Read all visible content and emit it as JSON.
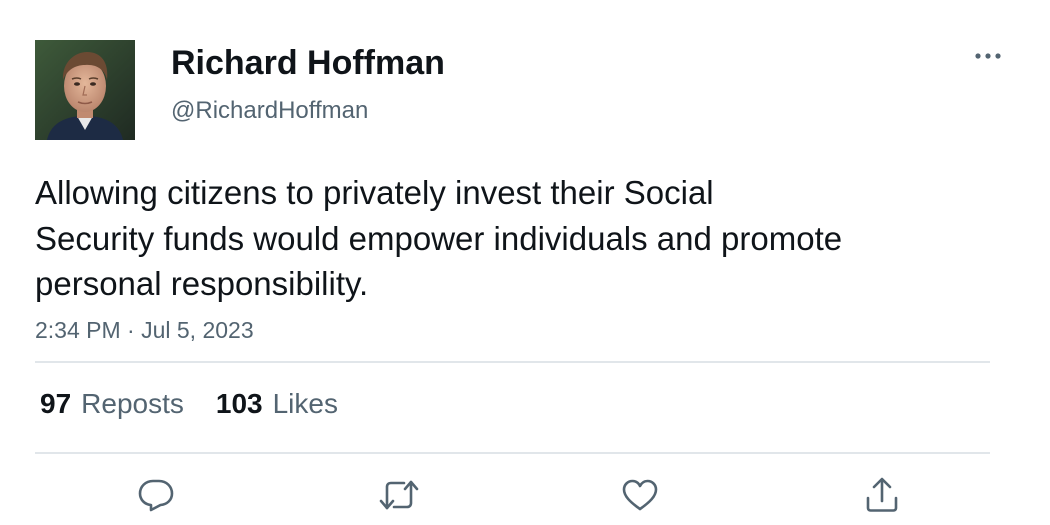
{
  "author": {
    "display_name": "Richard Hoffman",
    "handle": "@RichardHoffman",
    "avatar_icon": "profile-photo"
  },
  "tweet": {
    "text_lines": [
      "Allowing citizens to privately invest their Social",
      "Security funds would empower individuals and promote",
      "personal responsibility."
    ],
    "timestamp": "2:34 PM · Jul 5, 2023"
  },
  "stats": {
    "reposts_count": "97",
    "reposts_label": "Reposts",
    "likes_count": "103",
    "likes_label": "Likes"
  },
  "actions": {
    "reply_icon": "reply-icon",
    "repost_icon": "repost-icon",
    "like_icon": "heart-icon",
    "share_icon": "share-icon"
  },
  "menu": {
    "more_icon": "more-icon"
  },
  "colors": {
    "text_primary": "#0f1419",
    "text_secondary": "#536471",
    "divider": "#e1e6ea"
  }
}
